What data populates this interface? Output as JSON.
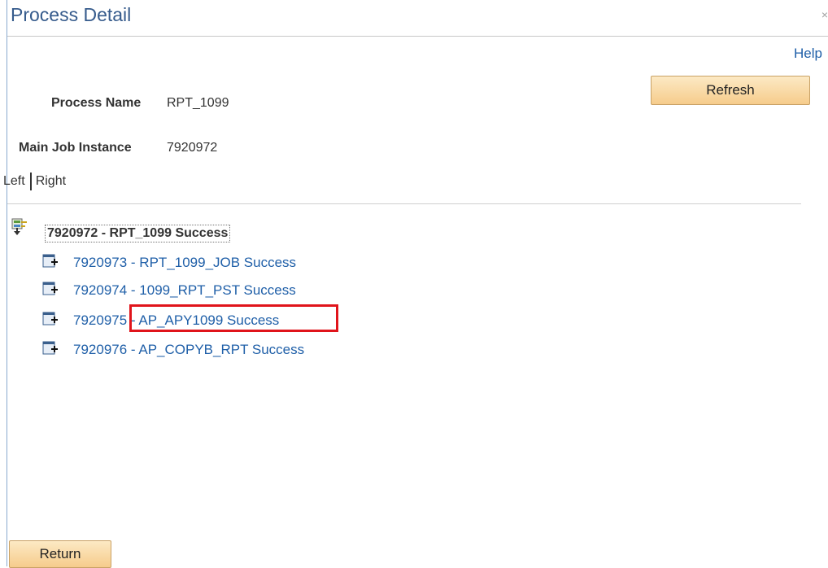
{
  "window": {
    "title": "Process Detail",
    "close_glyph": "×"
  },
  "toolbar": {
    "help_label": "Help",
    "refresh_label": "Refresh"
  },
  "process": {
    "name_label": "Process Name",
    "name_value": "RPT_1099",
    "job_label": "Main Job Instance",
    "job_value": "7920972"
  },
  "scroll": {
    "left_label": "Left",
    "right_label": "Right"
  },
  "tree": {
    "root": {
      "label": "7920972 - RPT_1099 Success",
      "icon": "job-tree-icon"
    },
    "children": [
      {
        "label": "7920973 - RPT_1099_JOB Success",
        "icon": "process-icon"
      },
      {
        "label": "7920974 - 1099_RPT_PST Success",
        "icon": "process-icon"
      },
      {
        "label": "7920975 - AP_APY1099 Success",
        "icon": "process-icon",
        "highlighted": true
      },
      {
        "label": "7920976 - AP_COPYB_RPT Success",
        "icon": "process-icon"
      }
    ]
  },
  "footer": {
    "return_label": "Return"
  },
  "colors": {
    "title": "#365b8c",
    "link": "#1f5fa8",
    "highlight": "#e0141b",
    "button": "#f6cc8c"
  }
}
